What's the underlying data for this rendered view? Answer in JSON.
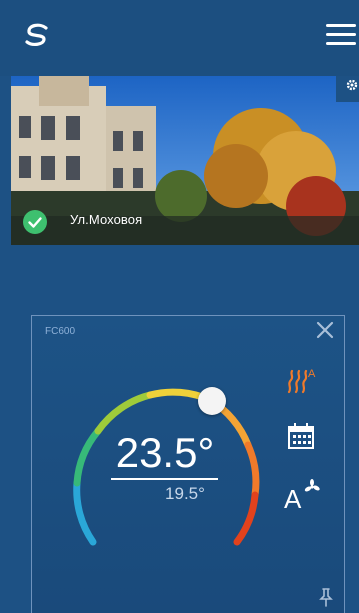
{
  "header": {
    "logo_icon": "s-swirl-logo-icon",
    "menu_icon": "hamburger-menu-icon"
  },
  "location": {
    "name": "Ул.Моховоя",
    "status_icon": "check-circle-icon",
    "settings_icon": "gear-icon"
  },
  "device": {
    "id": "FC600",
    "temperature": "23.5°",
    "setpoint": "19.5°",
    "close_icon": "close-icon",
    "pin_icon": "pin-icon",
    "modes": [
      {
        "name": "heat-auto-icon",
        "label": "A"
      },
      {
        "name": "schedule-calendar-icon"
      },
      {
        "name": "fan-auto-icon",
        "label": "A"
      }
    ]
  },
  "colors": {
    "background": "#1d5184",
    "accent_heat": "#f07a2a",
    "success": "#3ec06f"
  }
}
